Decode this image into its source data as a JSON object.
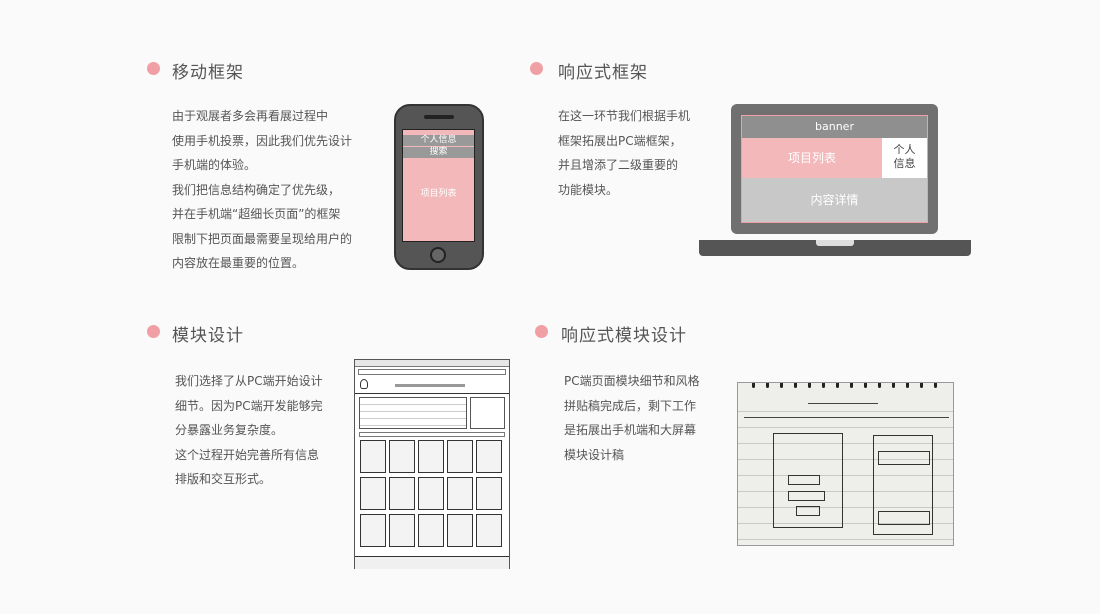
{
  "sections": {
    "mobile": {
      "title": "移动框架",
      "body": "由于观展者多会再看展过程中\n使用手机投票，因此我们优先设计\n手机端的体验。\n我们把信息结构确定了优先级，\n并在手机端“超细长页面”的框架\n限制下把页面最需要呈现给用户的\n内容放在最重要的位置。"
    },
    "responsive": {
      "title": "响应式框架",
      "body": "在这一环节我们根据手机\n框架拓展出PC端框架，\n并且增添了二级重要的\n功能模块。"
    },
    "module": {
      "title": "模块设计",
      "body": "我们选择了从PC端开始设计\n细节。因为PC端开发能够完\n分暴露业务复杂度。\n这个过程开始完善所有信息\n排版和交互形式。"
    },
    "responsive_module": {
      "title": "响应式模块设计",
      "body": "PC端页面模块细节和风格\n拼贴稿完成后，剩下工作\n是拓展出手机端和大屏幕\n模块设计稿"
    }
  },
  "phone_mock": {
    "personal_info": "个人信息",
    "search": "搜索",
    "project_list": "项目列表"
  },
  "laptop_mock": {
    "banner": "banner",
    "project_list": "项目列表",
    "personal_info": "个人\n信息",
    "detail": "内容详情"
  },
  "colors": {
    "accent": "#f0a0a4",
    "pink_block": "#f2b8ba",
    "gray_block": "#c8c8c8",
    "dark_gray": "#707070"
  }
}
